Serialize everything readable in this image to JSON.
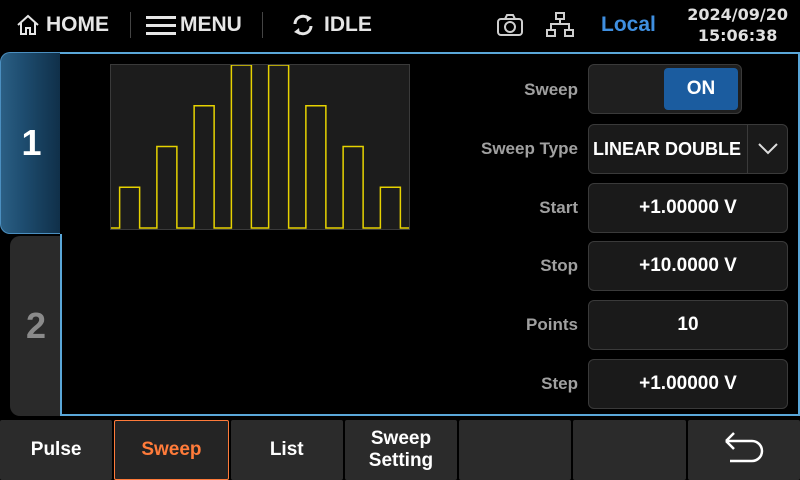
{
  "topbar": {
    "home_label": "HOME",
    "menu_label": "MENU",
    "status_label": "IDLE",
    "mode_label": "Local",
    "date": "2024/09/20",
    "time": "15:06:38"
  },
  "channels": [
    "1",
    "2"
  ],
  "settings": {
    "sweep": {
      "label": "Sweep",
      "value": "ON"
    },
    "sweep_type": {
      "label": "Sweep Type",
      "value": "LINEAR DOUBLE"
    },
    "start": {
      "label": "Start",
      "value": "+1.00000 V"
    },
    "stop": {
      "label": "Stop",
      "value": "+10.0000 V"
    },
    "points": {
      "label": "Points",
      "value": "10"
    },
    "step": {
      "label": "Step",
      "value": "+1.00000 V"
    }
  },
  "waveform": {
    "levels": [
      1,
      2,
      3,
      4,
      4,
      3,
      2,
      1
    ],
    "color": "#e6d200"
  },
  "softkeys": [
    "Pulse",
    "Sweep",
    "List",
    "Sweep\nSetting",
    "",
    "",
    ""
  ],
  "colors": {
    "accent": "#5aa7d9",
    "active_softkey": "#ff7b3a",
    "on_button": "#1b5c9f",
    "local": "#3f8fe0"
  }
}
